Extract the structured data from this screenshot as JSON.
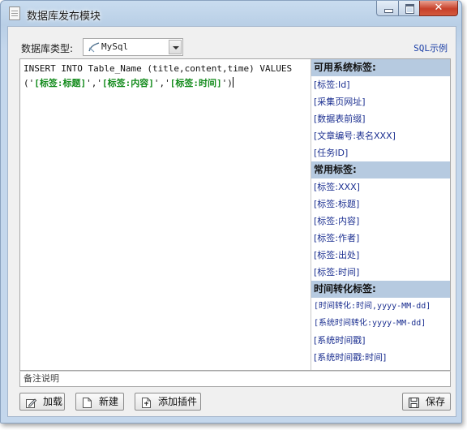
{
  "window": {
    "title": "数据库发布模块",
    "ghost_text": "            ",
    "close_glyph": "✕"
  },
  "toolbar": {
    "dbtype_label": "数据库类型:",
    "dbtype_value": "MySql",
    "sql_example_link": "SQL示例"
  },
  "editor": {
    "sql_prefix": "INSERT INTO Table_Name (title,content,time) VALUES ('",
    "tag1": "[标签:标题]",
    "sep1": "','",
    "tag2": "[标签:内容]",
    "sep2": "','",
    "tag3": "[标签:时间]",
    "sql_suffix": "')"
  },
  "tags_panel": {
    "system_header": "可用系统标签:",
    "system_items": [
      "[标签:Id]",
      "[采集页网址]",
      "[数据表前缀]",
      "[文章编号:表名XXX]",
      "[任务ID]"
    ],
    "common_header": "常用标签:",
    "common_items": [
      "[标签:XXX]",
      "[标签:标题]",
      "[标签:内容]",
      "[标签:作者]",
      "[标签:出处]",
      "[标签:时间]"
    ],
    "time_header": "时间转化标签:",
    "time_items": [
      "[时间转化:时间,yyyy-MM-dd]",
      "[系统时间转化:yyyy-MM-dd]",
      "[系统时间戳]",
      "[系统时间戳:时间]"
    ]
  },
  "notes": {
    "placeholder": "备注说明"
  },
  "buttons": {
    "load": "加载",
    "new": "新建",
    "add_plugin": "添加插件",
    "save": "保存"
  },
  "icons": {
    "window": "document-icon",
    "db": "db-brush-icon",
    "load": "edit-icon",
    "new": "new-document-icon",
    "plugin": "plugin-document-icon",
    "save": "floppy-disk-icon"
  }
}
